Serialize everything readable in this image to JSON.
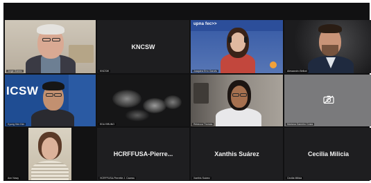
{
  "window": {
    "top_bar": "",
    "bottom_bar": ""
  },
  "tiles": [
    {
      "id": "t1",
      "name": "Jorge Gómez",
      "type": "video"
    },
    {
      "id": "t2",
      "name": "KNCSW",
      "label": "KNCSW",
      "type": "name-only"
    },
    {
      "id": "t3",
      "name": "Joaquina Erro Garcés",
      "type": "video",
      "banner_brand": "upna  fec>>"
    },
    {
      "id": "t4",
      "name": "Alessandro Belloni",
      "type": "video"
    },
    {
      "id": "t5",
      "name": "Kyung Hee Kim",
      "type": "video",
      "background_text": "ICSW"
    },
    {
      "id": "t6",
      "name": "EDU BRUNO",
      "type": "video"
    },
    {
      "id": "t7",
      "name": "Rebecca Thomas",
      "type": "video"
    },
    {
      "id": "t8",
      "name": "Mariana Gameiro Costa",
      "type": "camera-off",
      "icon": "camera-off-icon"
    },
    {
      "id": "t9",
      "name": "Ann Nowy",
      "type": "video"
    },
    {
      "id": "t10",
      "name": "HCRFFUSA-Pierrette J. Cazeau",
      "label": "HCRFFUSA-Pierre...",
      "type": "name-only"
    },
    {
      "id": "t11",
      "name": "Xanthis Suárez",
      "label": "Xanthis Suárez",
      "type": "name-only"
    },
    {
      "id": "t12",
      "name": "Cecilia Milicia",
      "label": "Cecilia Milicia",
      "type": "name-only"
    }
  ]
}
